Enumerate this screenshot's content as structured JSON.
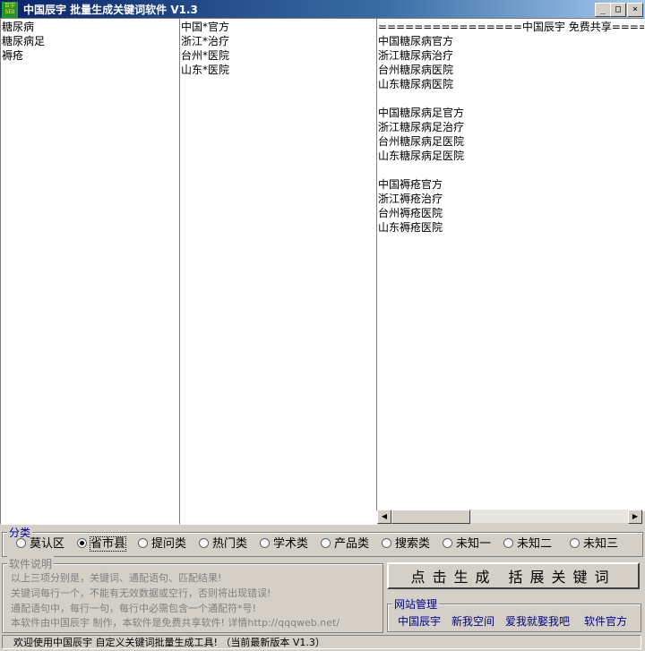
{
  "window": {
    "icon_text": "百宇SEO",
    "title": "中国辰宇  批量生成关键词软件 V1.3",
    "buttons": {
      "minimize": "_",
      "maximize": "□",
      "close": "×"
    }
  },
  "panels": {
    "keywords": [
      "糖尿病",
      "糖尿病足",
      "褥疮"
    ],
    "patterns": [
      "中国*官方",
      "浙江*治疗",
      "台州*医院",
      "山东*医院"
    ],
    "results": [
      "================中国辰宇 免费共享================",
      "中国糖尿病官方",
      "浙江糖尿病治疗",
      "台州糖尿病医院",
      "山东糖尿病医院",
      "",
      "中国糖尿病足官方",
      "浙江糖尿病足治疗",
      "台州糖尿病足医院",
      "山东糖尿病足医院",
      "",
      "中国褥疮官方",
      "浙江褥疮治疗",
      "台州褥疮医院",
      "山东褥疮医院"
    ]
  },
  "scrollbar": {
    "left_arrow": "◀",
    "right_arrow": "▶"
  },
  "category": {
    "legend": "分类",
    "options": [
      "莫认区",
      "省市县",
      "提问类",
      "热门类",
      "学术类",
      "产品类",
      "搜索类",
      "未知一",
      "未知二",
      "未知三"
    ],
    "selected": "省市县"
  },
  "help": {
    "legend": "软件说明",
    "lines": [
      "以上三项分别是，关键词、通配语句、匹配结果!",
      "关键词每行一个，不能有无效数据或空行，否则将出现错误!",
      "通配语句中，每行一句，每行中必需包含一个通配符*号!",
      "本软件由中国辰宇 制作，本软件是免费共享软件! 详情http://qqqweb.net/"
    ]
  },
  "generate_button": "点击生成  括展关键词",
  "site": {
    "legend": "网站管理",
    "links": [
      "中国辰宇",
      "新我空间",
      "爱我就娶我吧",
      "软件官方"
    ]
  },
  "status": "欢迎使用中国辰宇 自定义关键词批量生成工具! （当前最新版本 V1.3）"
}
